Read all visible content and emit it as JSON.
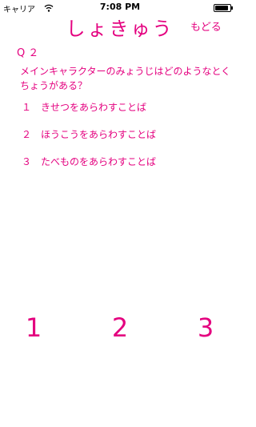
{
  "status_bar": {
    "carrier": "キャリア",
    "time": "7:08 PM",
    "battery_level": 0.9
  },
  "header": {
    "title": "しょきゅう",
    "back_label": "もどる"
  },
  "question": {
    "number": "Q２",
    "text": "メインキャラクターのみょうじはどのようなとくちょうがある？"
  },
  "choices": [
    {
      "num": "１",
      "text": "きせつをあらわすことば"
    },
    {
      "num": "２",
      "text": "ほうこうをあらわすことば"
    },
    {
      "num": "３",
      "text": "たべものをあらわすことば"
    }
  ],
  "answer_buttons": [
    "1",
    "2",
    "3"
  ],
  "colors": {
    "accent": "#e4007f"
  }
}
